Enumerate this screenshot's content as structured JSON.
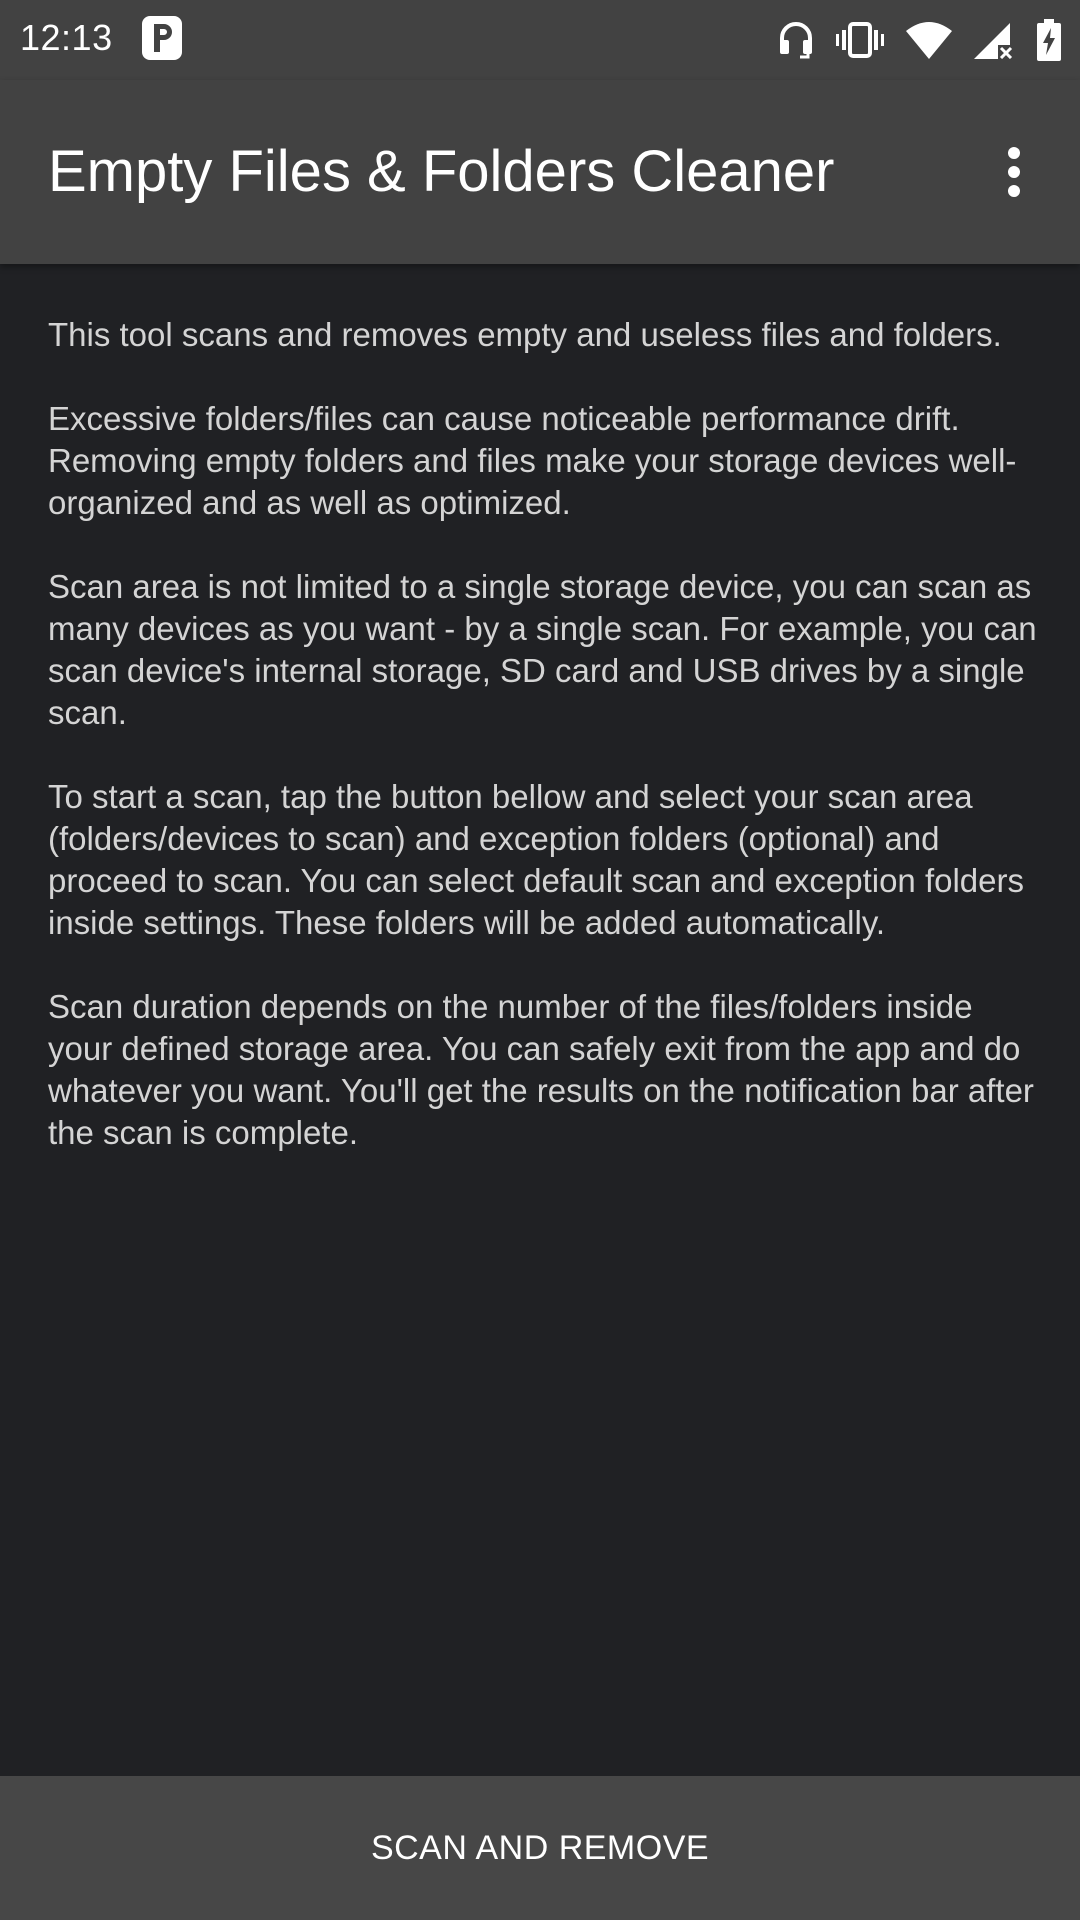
{
  "status_bar": {
    "time": "12:13",
    "icons": [
      "parking-icon",
      "headset-icon",
      "vibrate-icon",
      "wifi-icon",
      "signal-icon",
      "battery-charging-icon"
    ]
  },
  "app_bar": {
    "title": "Empty Files & Folders Cleaner",
    "menu_icon": "more-vert-icon"
  },
  "content": {
    "paragraphs": [
      "This tool scans and removes empty and useless files and folders.",
      "Excessive folders/files can cause noticeable performance drift. Removing empty folders and files make your storage devices well-organized and as well as optimized.",
      "Scan area is not limited to a single storage device, you can scan as many devices as you want - by a single scan. For example, you can scan device's internal storage, SD card and USB drives by a single scan.",
      "To start a scan, tap the button bellow and select your scan area (folders/devices to scan) and exception folders (optional) and proceed to scan. You can select default scan and exception folders inside settings. These folders will be added automatically.",
      "Scan duration depends on the number of the files/folders inside your defined storage area. You can safely exit from the app and do whatever you want. You'll get the results on the notification bar after the scan is complete."
    ]
  },
  "action": {
    "button_label": "SCAN AND REMOVE"
  },
  "colors": {
    "background": "#202124",
    "bar": "#424242",
    "text": "#d4d4d4",
    "button": "#474747"
  }
}
